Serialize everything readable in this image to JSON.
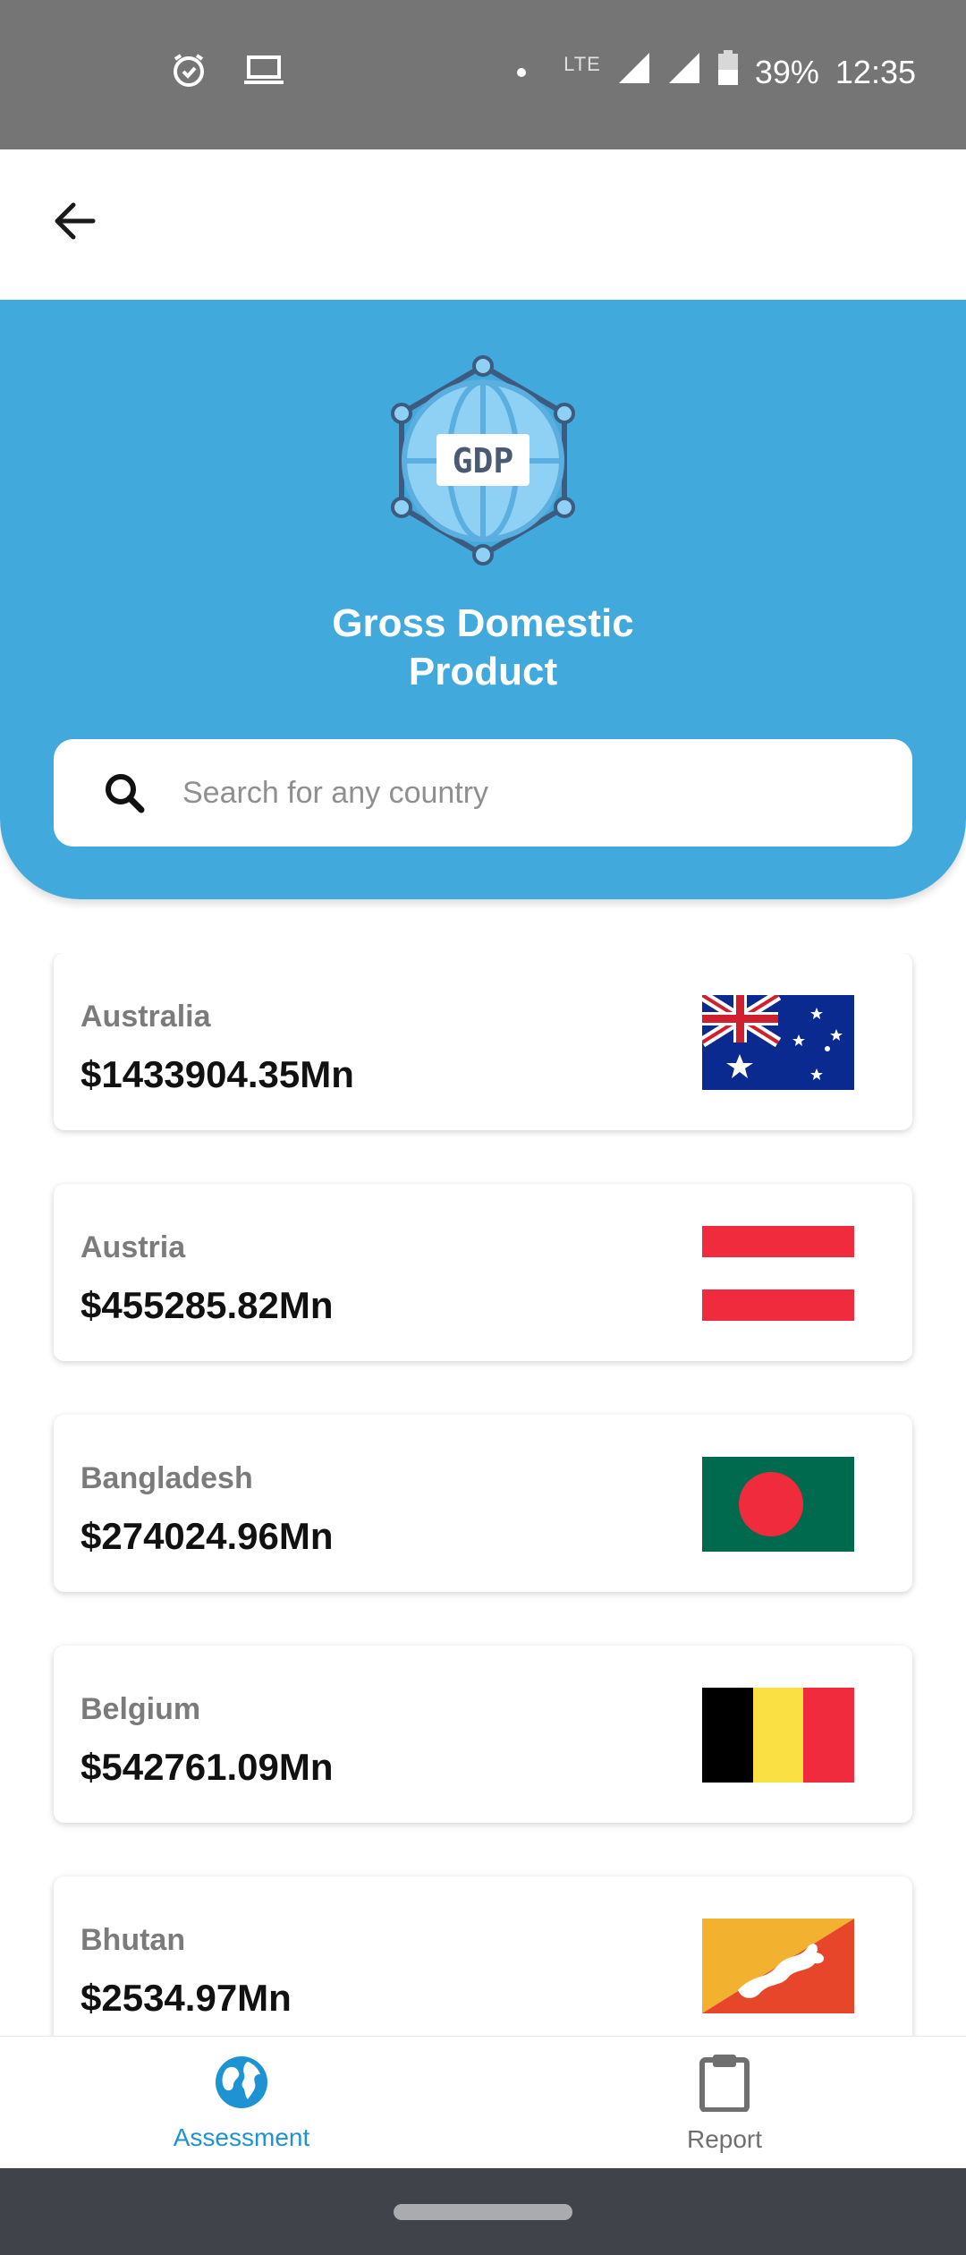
{
  "status_bar": {
    "battery": "39%",
    "time": "12:35",
    "network": "LTE",
    "icons": [
      "alarm-icon",
      "laptop-icon",
      "dot-icon",
      "signal-icon",
      "signal-icon",
      "battery-icon"
    ]
  },
  "app_bar": {
    "back_icon": "arrow-left-icon"
  },
  "header": {
    "logo_text": "GDP",
    "title_line1": "Gross Domestic",
    "title_line2": "Product",
    "background_color": "#42a9dd"
  },
  "search": {
    "placeholder": "Search for any country",
    "value": ""
  },
  "countries": [
    {
      "name": "Australia",
      "gdp": "$1433904.35Mn",
      "flag": "australia-flag"
    },
    {
      "name": "Austria",
      "gdp": "$455285.82Mn",
      "flag": "austria-flag"
    },
    {
      "name": "Bangladesh",
      "gdp": "$274024.96Mn",
      "flag": "bangladesh-flag"
    },
    {
      "name": "Belgium",
      "gdp": "$542761.09Mn",
      "flag": "belgium-flag"
    },
    {
      "name": "Bhutan",
      "gdp": "$2534.97Mn",
      "flag": "bhutan-flag"
    }
  ],
  "bottom_nav": {
    "items": [
      {
        "label": "Assessment",
        "icon": "globe-icon",
        "active": true
      },
      {
        "label": "Report",
        "icon": "clipboard-icon",
        "active": false
      }
    ],
    "active_color": "#1e93d3"
  }
}
